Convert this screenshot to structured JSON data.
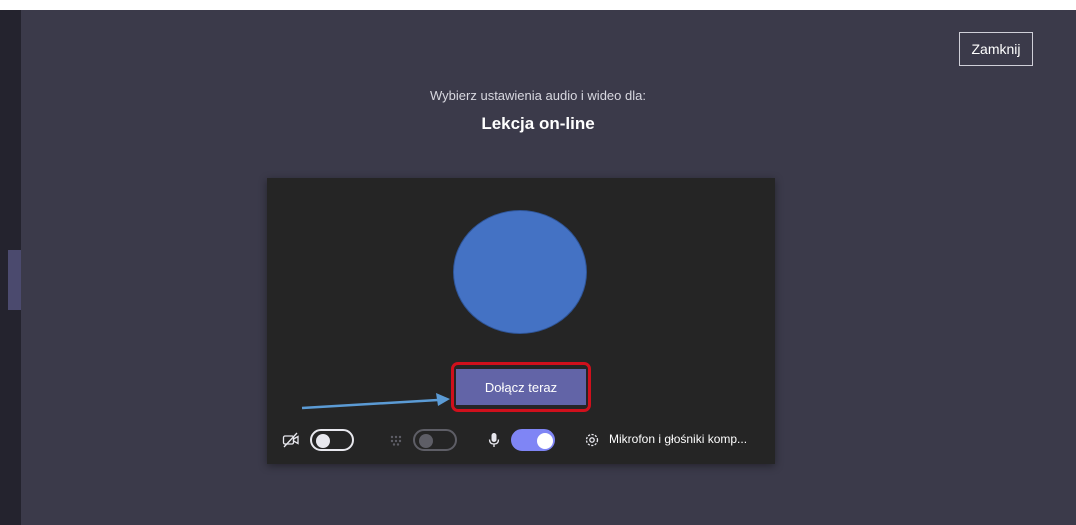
{
  "header": {
    "close_label": "Zamknij"
  },
  "prejoin": {
    "subtitle": "Wybierz ustawienia audio i wideo dla:",
    "meeting_title": "Lekcja on-line",
    "join_label": "Dołącz teraz",
    "avatar_color": "#4472c4",
    "highlight_color": "#d0101c",
    "arrow_color": "#5b9bd5"
  },
  "controls": {
    "camera": {
      "icon": "camera-off-icon",
      "enabled": false
    },
    "background": {
      "icon": "background-effects-icon",
      "enabled": false,
      "disabled": true
    },
    "microphone": {
      "icon": "microphone-icon",
      "enabled": true
    },
    "device_settings": {
      "icon": "gear-icon",
      "label": "Mikrofon i głośniki komp..."
    }
  },
  "theme": {
    "background": "#3b3a4a",
    "card": "#252525",
    "accent": "#6264a7",
    "toggle_on": "#7f85f5"
  }
}
